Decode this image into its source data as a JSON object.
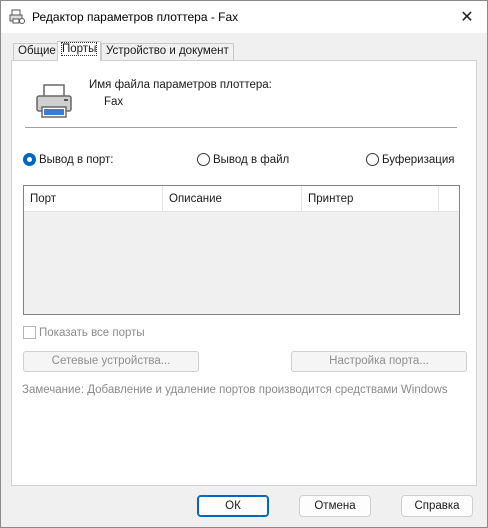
{
  "window": {
    "title": "Редактор параметров плоттера - Fax",
    "close_symbol": "✕"
  },
  "tabs": [
    {
      "label": "Общие",
      "active": false
    },
    {
      "label": "Порты",
      "active": true
    },
    {
      "label": "Устройство и документ",
      "active": false
    }
  ],
  "ports_tab": {
    "file_label": "Имя файла параметров плоттера:",
    "file_value": "Fax",
    "radios": [
      {
        "label": "Вывод в порт:",
        "checked": true
      },
      {
        "label": "Вывод в файл",
        "checked": false
      },
      {
        "label": "Буферизация",
        "checked": false
      }
    ],
    "columns": [
      "Порт",
      "Описание",
      "Принтер"
    ],
    "show_all_ports": "Показать все порты",
    "network_button": "Сетевые устройства...",
    "port_config_button": "Настройка порта...",
    "note": "Замечание: Добавление и удаление портов производится средствами Windows"
  },
  "footer": {
    "ok": "ОК",
    "cancel": "Отмена",
    "help": "Справка"
  },
  "colors": {
    "accent": "#0067c0",
    "disabled_text": "#8a8a8a"
  }
}
